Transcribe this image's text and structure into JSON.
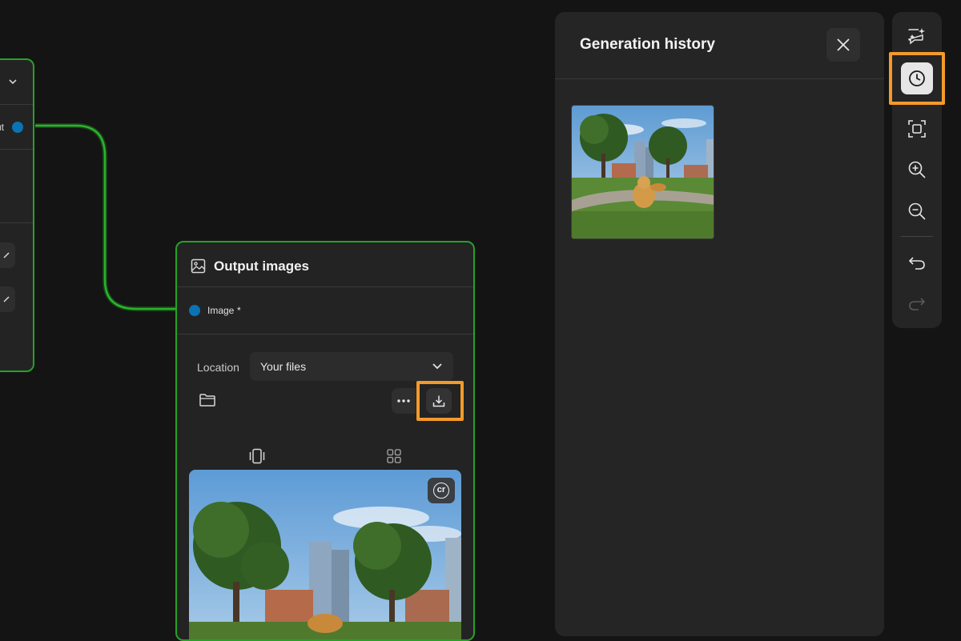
{
  "left_node": {
    "port_label": "ut"
  },
  "output_node": {
    "title": "Output images",
    "port_label": "Image",
    "required_marker": "*",
    "location_label": "Location",
    "location_value": "Your files",
    "preview_badge": "cr"
  },
  "history": {
    "title": "Generation history",
    "items": [
      {
        "thumbnail": "golden-retriever-in-park"
      }
    ]
  },
  "toolbar": {
    "items": [
      "ai-chat-icon",
      "history-icon",
      "fit-screen-icon",
      "zoom-in-icon",
      "zoom-out-icon",
      "undo-icon",
      "redo-icon"
    ],
    "active": "history-icon"
  },
  "colors": {
    "accent_orange": "#f39a2b",
    "node_border": "#26a126",
    "port_blue": "#0b73b3"
  }
}
